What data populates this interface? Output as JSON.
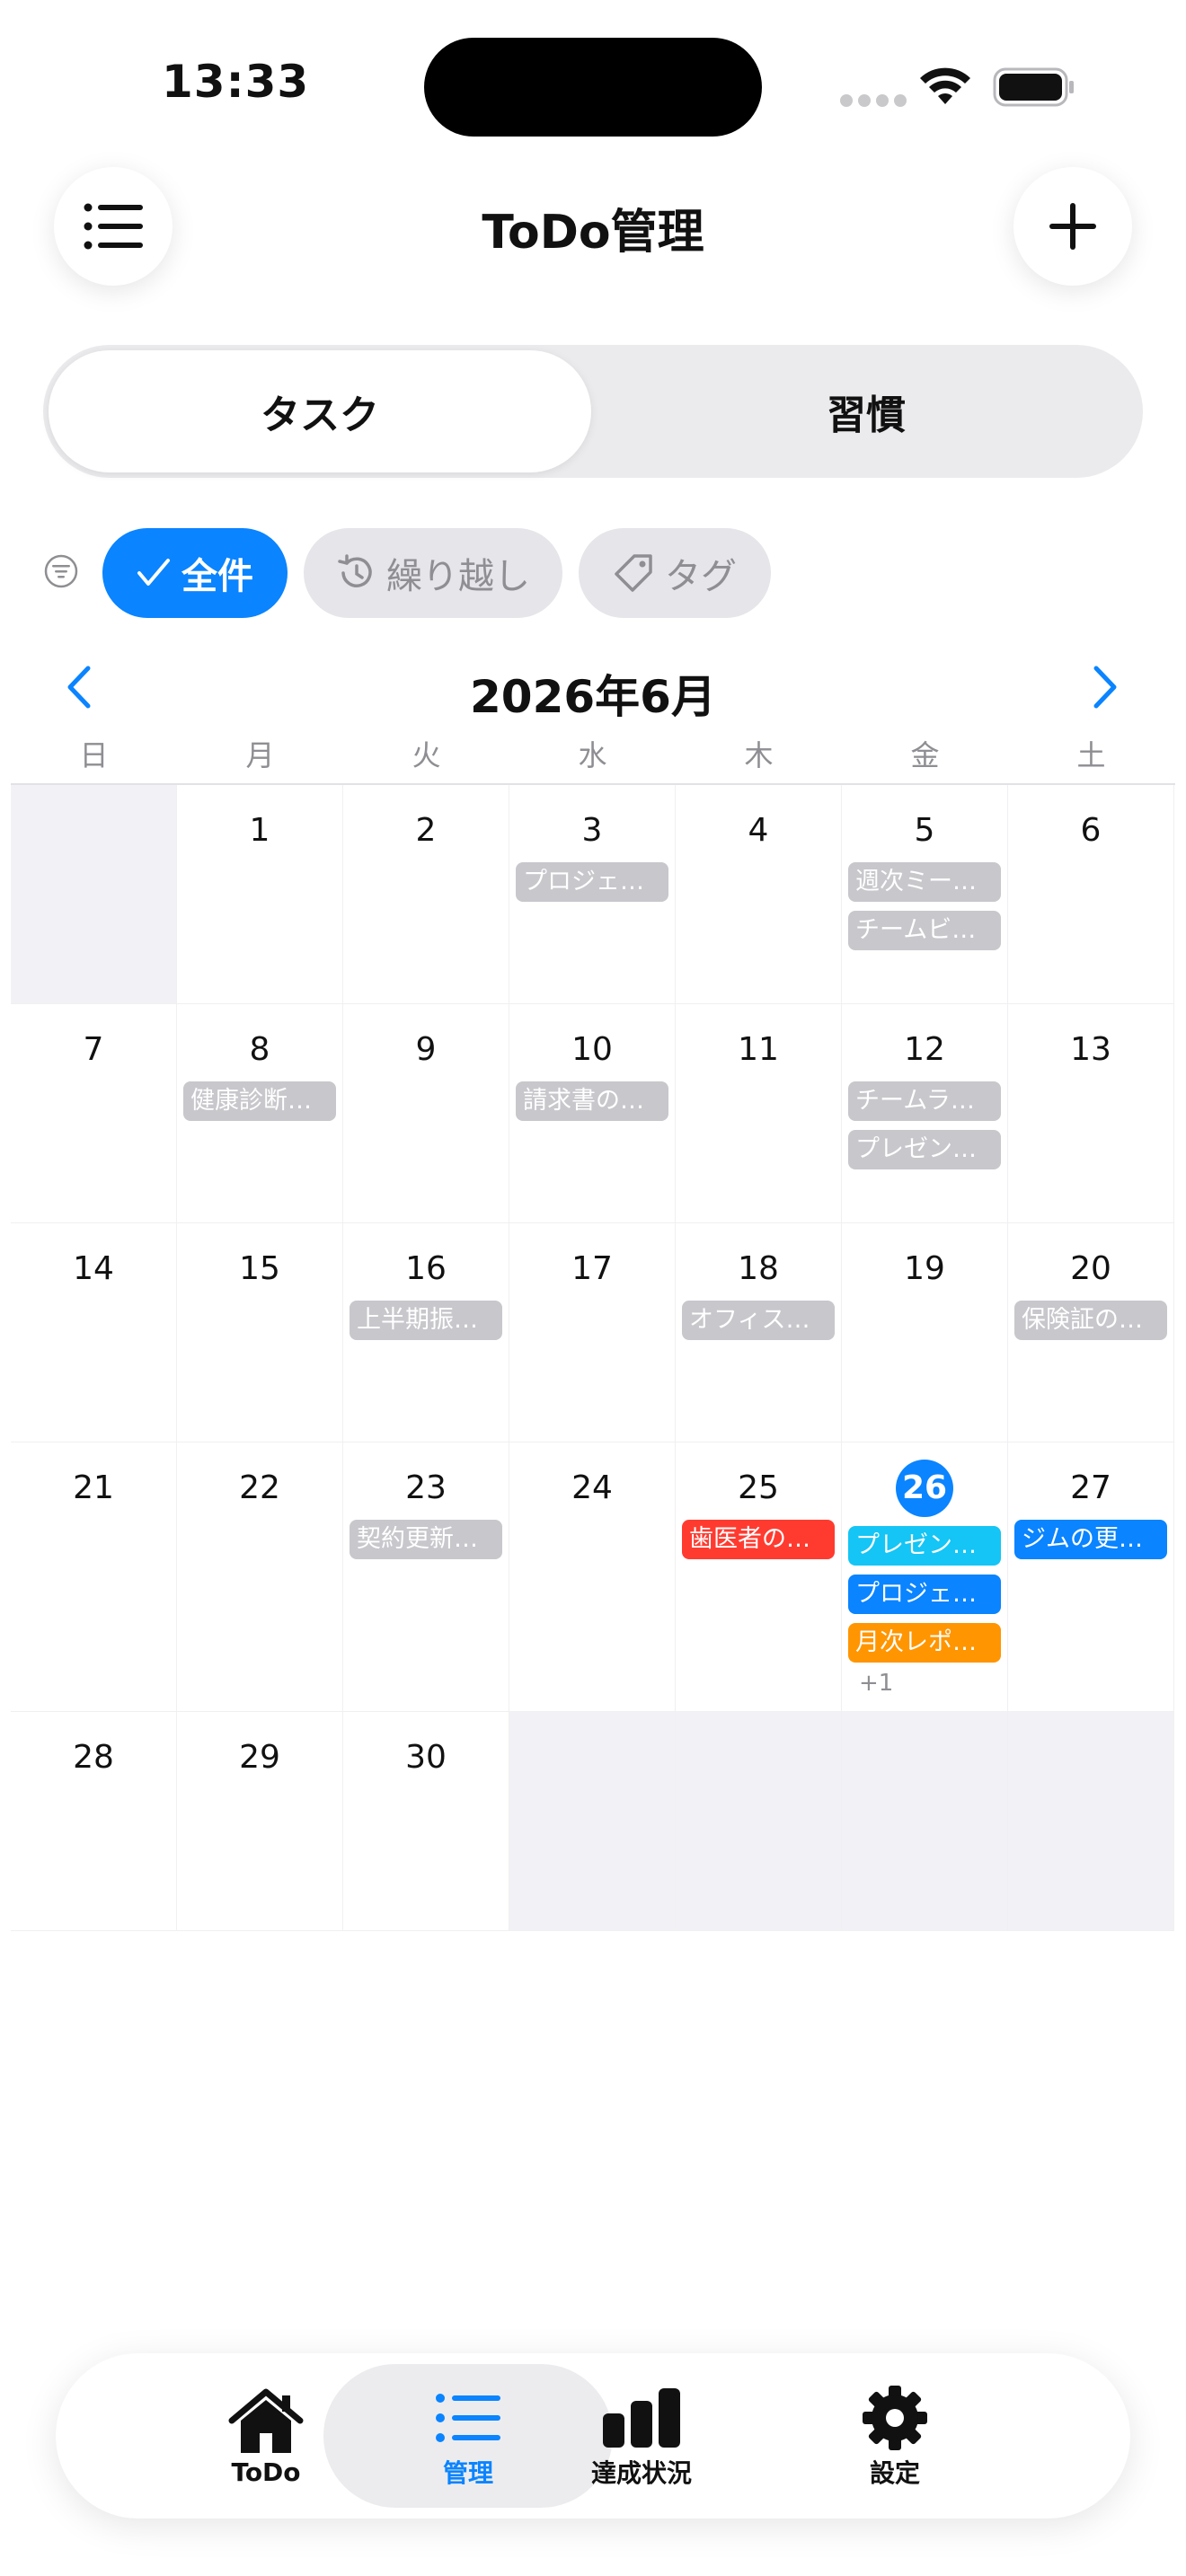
{
  "status_bar": {
    "time": "13:33"
  },
  "header": {
    "title": "ToDo管理",
    "menu_icon": "list-icon",
    "add_icon": "plus-icon"
  },
  "segments": [
    {
      "label": "タスク",
      "selected": true
    },
    {
      "label": "習慣",
      "selected": false
    }
  ],
  "filters": {
    "all": "全件",
    "carryover": "繰り越し",
    "tag": "タグ"
  },
  "calendar": {
    "month_label": "2026年6月",
    "weekdays": [
      "日",
      "月",
      "火",
      "水",
      "木",
      "金",
      "土"
    ],
    "weeks": [
      [
        {
          "day": "",
          "events": []
        },
        {
          "day": "1",
          "events": []
        },
        {
          "day": "2",
          "events": []
        },
        {
          "day": "3",
          "events": [
            {
              "title": "プロジェ…",
              "color": "gray"
            }
          ]
        },
        {
          "day": "4",
          "events": []
        },
        {
          "day": "5",
          "events": [
            {
              "title": "週次ミー…",
              "color": "gray"
            },
            {
              "title": "チームビ…",
              "color": "gray"
            }
          ]
        },
        {
          "day": "6",
          "events": []
        }
      ],
      [
        {
          "day": "7",
          "events": []
        },
        {
          "day": "8",
          "events": [
            {
              "title": "健康診断…",
              "color": "gray"
            }
          ]
        },
        {
          "day": "9",
          "events": []
        },
        {
          "day": "10",
          "events": [
            {
              "title": "請求書の…",
              "color": "gray"
            }
          ]
        },
        {
          "day": "11",
          "events": []
        },
        {
          "day": "12",
          "events": [
            {
              "title": "チームラ…",
              "color": "gray"
            },
            {
              "title": "プレゼン…",
              "color": "gray"
            }
          ]
        },
        {
          "day": "13",
          "events": []
        }
      ],
      [
        {
          "day": "14",
          "events": []
        },
        {
          "day": "15",
          "events": []
        },
        {
          "day": "16",
          "events": [
            {
              "title": "上半期振…",
              "color": "gray"
            }
          ]
        },
        {
          "day": "17",
          "events": []
        },
        {
          "day": "18",
          "events": [
            {
              "title": "オフィス…",
              "color": "gray"
            }
          ]
        },
        {
          "day": "19",
          "events": []
        },
        {
          "day": "20",
          "events": [
            {
              "title": "保険証の…",
              "color": "gray"
            }
          ]
        }
      ],
      [
        {
          "day": "21",
          "events": []
        },
        {
          "day": "22",
          "events": []
        },
        {
          "day": "23",
          "events": [
            {
              "title": "契約更新…",
              "color": "gray"
            }
          ]
        },
        {
          "day": "24",
          "events": []
        },
        {
          "day": "25",
          "events": [
            {
              "title": "歯医者の…",
              "color": "red"
            }
          ]
        },
        {
          "day": "26",
          "today": true,
          "events": [
            {
              "title": "プレゼン…",
              "color": "cyan"
            },
            {
              "title": "プロジェ…",
              "color": "blue"
            },
            {
              "title": "月次レポ…",
              "color": "orange"
            }
          ],
          "more": "+1"
        },
        {
          "day": "27",
          "events": [
            {
              "title": "ジムの更…",
              "color": "blue"
            }
          ]
        }
      ],
      [
        {
          "day": "28",
          "events": []
        },
        {
          "day": "29",
          "events": []
        },
        {
          "day": "30",
          "events": []
        },
        {
          "day": "",
          "events": []
        },
        {
          "day": "",
          "events": []
        },
        {
          "day": "",
          "events": []
        },
        {
          "day": "",
          "events": []
        }
      ]
    ]
  },
  "tab_bar": [
    {
      "label": "ToDo",
      "icon": "house-icon",
      "active": false
    },
    {
      "label": "管理",
      "icon": "list-icon",
      "active": true
    },
    {
      "label": "達成状況",
      "icon": "bar-chart-icon",
      "active": false
    },
    {
      "label": "設定",
      "icon": "gear-icon",
      "active": false
    }
  ],
  "colors": {
    "accent": "#0a84ff",
    "event_gray": "#c7c7cc",
    "event_red": "#ff3b30",
    "event_cyan": "#14c5f5",
    "event_blue": "#0a84ff",
    "event_orange": "#ff9500"
  }
}
